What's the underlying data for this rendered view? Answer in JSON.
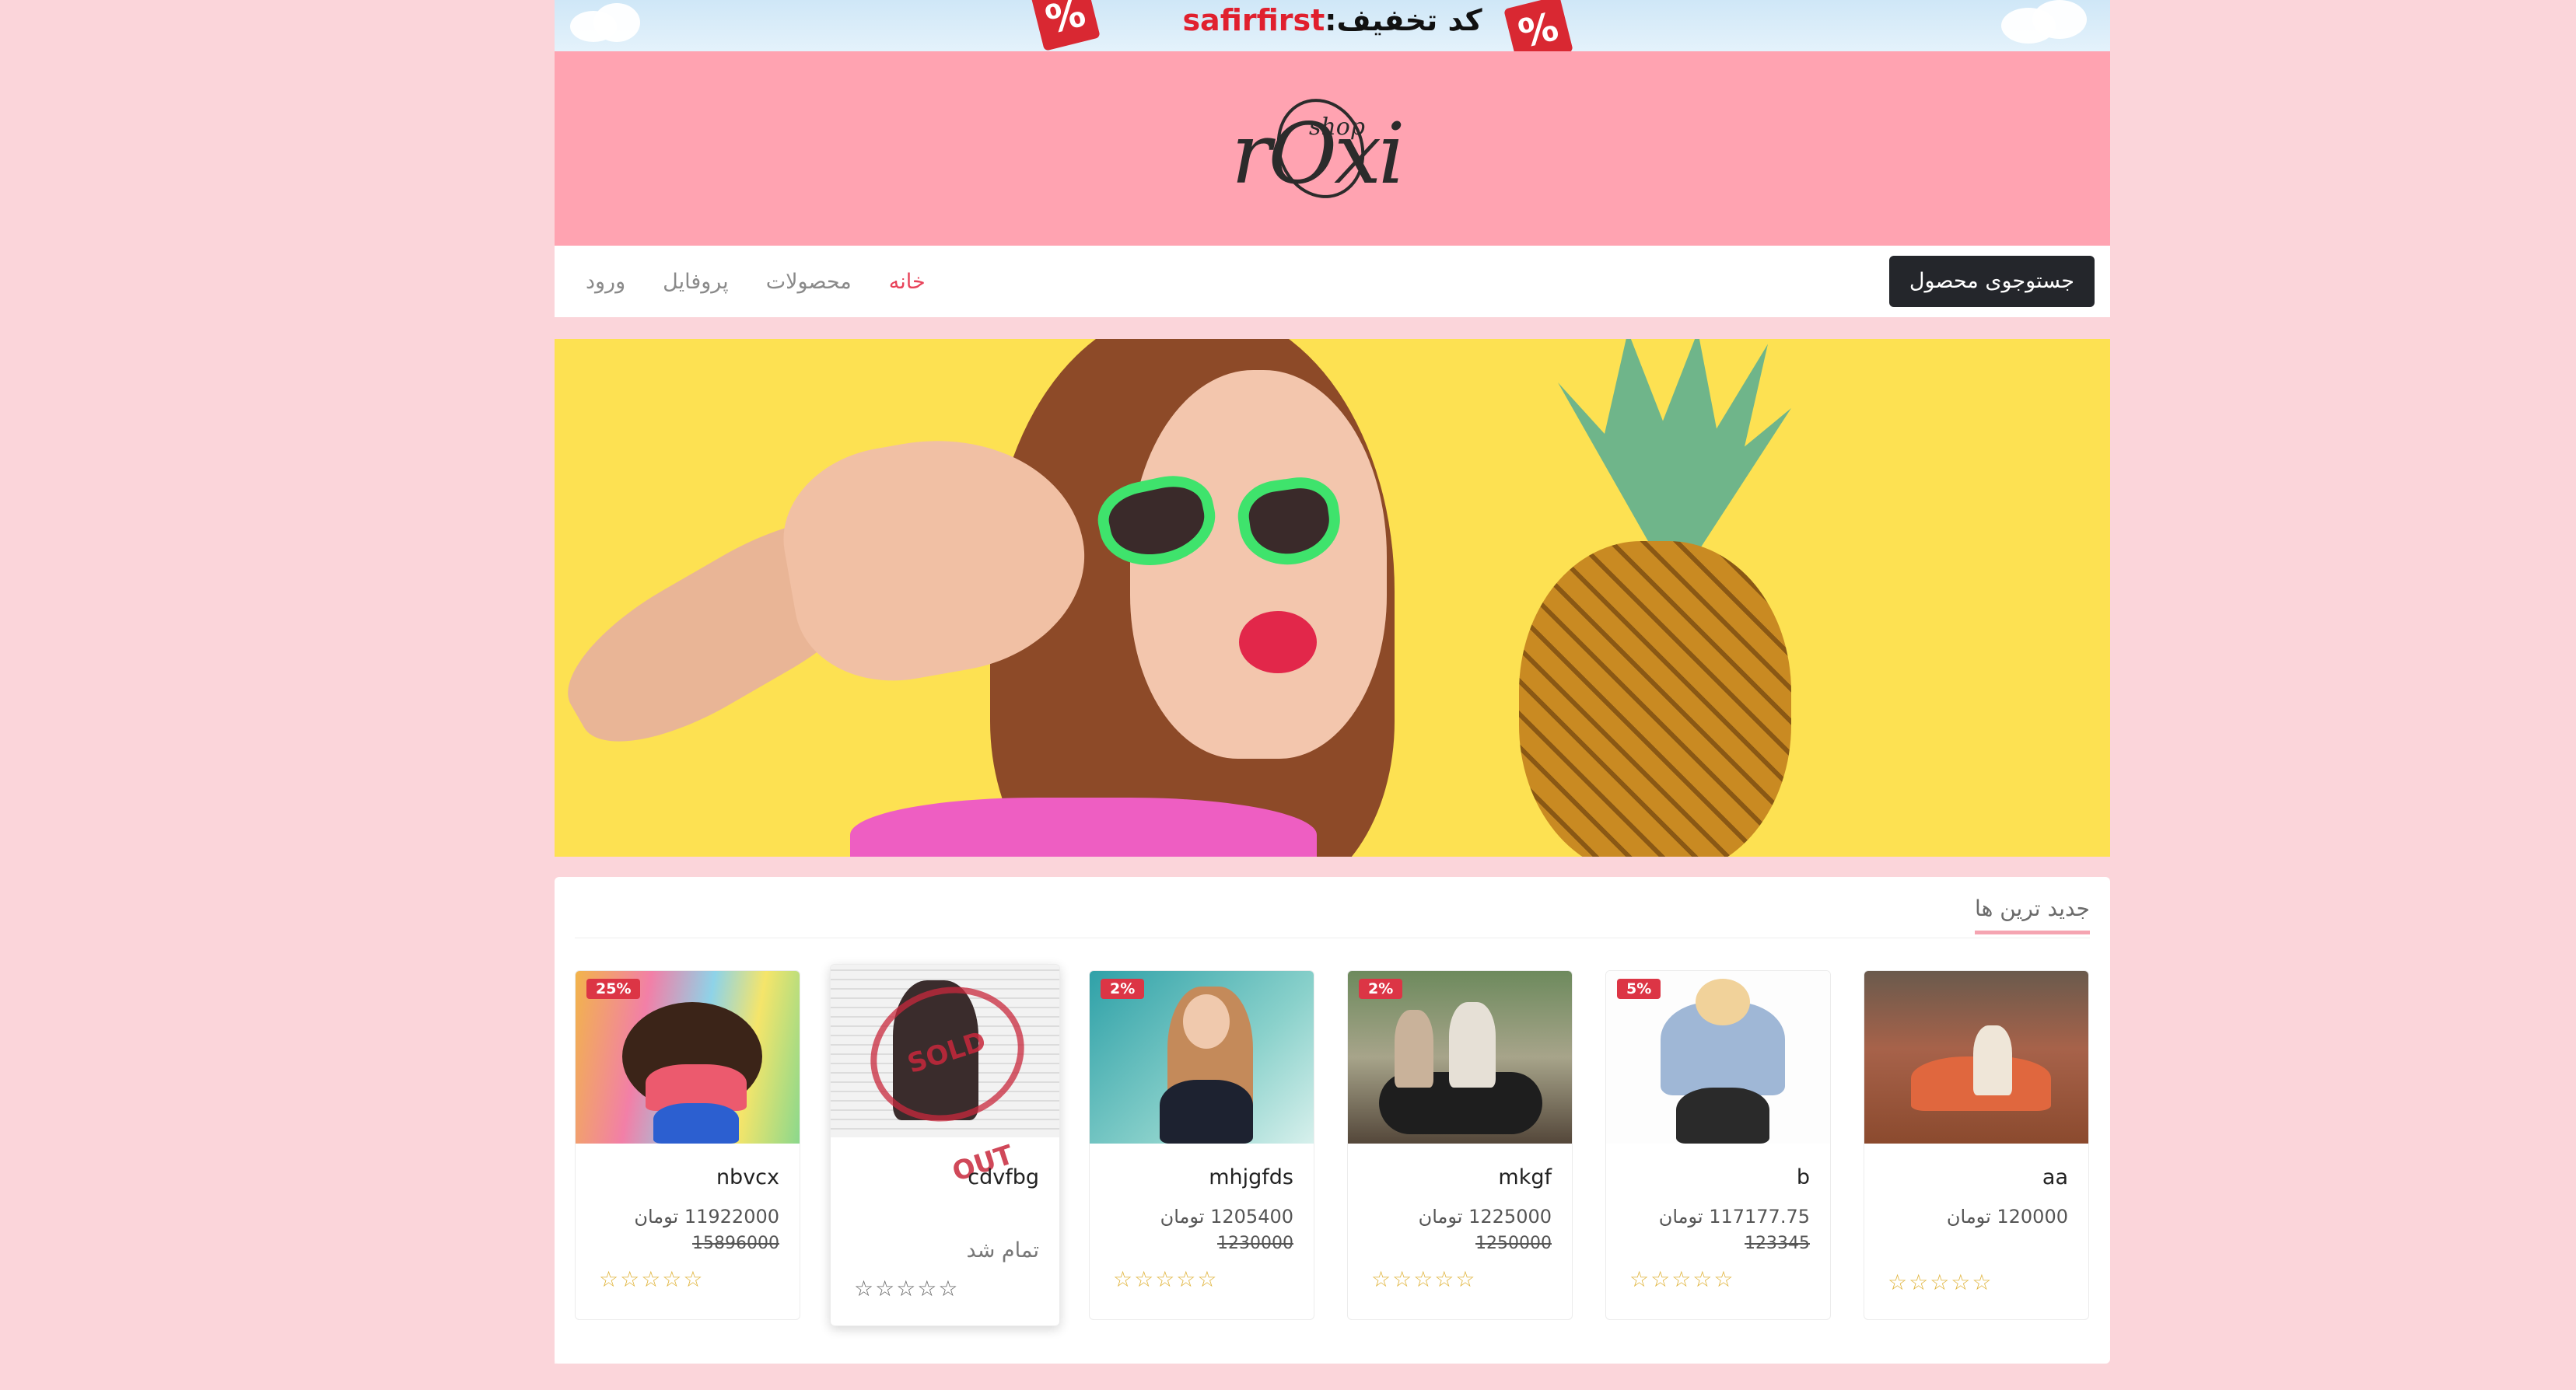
{
  "promo": {
    "text": "کد تخفیف:",
    "code": "safirfirst",
    "badge_symbol": "%"
  },
  "header": {
    "logo_main": "rOxi",
    "logo_sub": "shop"
  },
  "nav": {
    "search_button": "جستوجوی محصول",
    "links": [
      {
        "label": "خانه",
        "active": true
      },
      {
        "label": "محصولات",
        "active": false
      },
      {
        "label": "پروفایل",
        "active": false
      },
      {
        "label": "ورود",
        "active": false
      }
    ]
  },
  "newest": {
    "title": "جدید ترین ها",
    "products": [
      {
        "name": "aa",
        "price": "120000 تومان",
        "old_price": "",
        "discount": "",
        "status": "",
        "rating": 0
      },
      {
        "name": "b",
        "price": "117177.75 تومان",
        "old_price": "123345",
        "discount": "5%",
        "status": "",
        "rating": 0
      },
      {
        "name": "mkgf",
        "price": "1225000 تومان",
        "old_price": "1250000",
        "discount": "2%",
        "status": "",
        "rating": 0
      },
      {
        "name": "mhjgfds",
        "price": "1205400 تومان",
        "old_price": "1230000",
        "discount": "2%",
        "status": "",
        "rating": 0
      },
      {
        "name": "cdvfbg",
        "price": "",
        "old_price": "",
        "discount": "",
        "status": "تمام شد",
        "stamp": "SOLD OUT",
        "rating": 0
      },
      {
        "name": "nbvcx",
        "price": "11922000 تومان",
        "old_price": "15896000",
        "discount": "25%",
        "status": "",
        "rating": 0
      }
    ],
    "stars": "☆☆☆☆☆"
  },
  "colors": {
    "page_bg": "#fbd5da",
    "header_bg": "#ffa3b1",
    "accent": "#e8435a",
    "badge": "#dc3545",
    "star": "#e0b43c"
  }
}
